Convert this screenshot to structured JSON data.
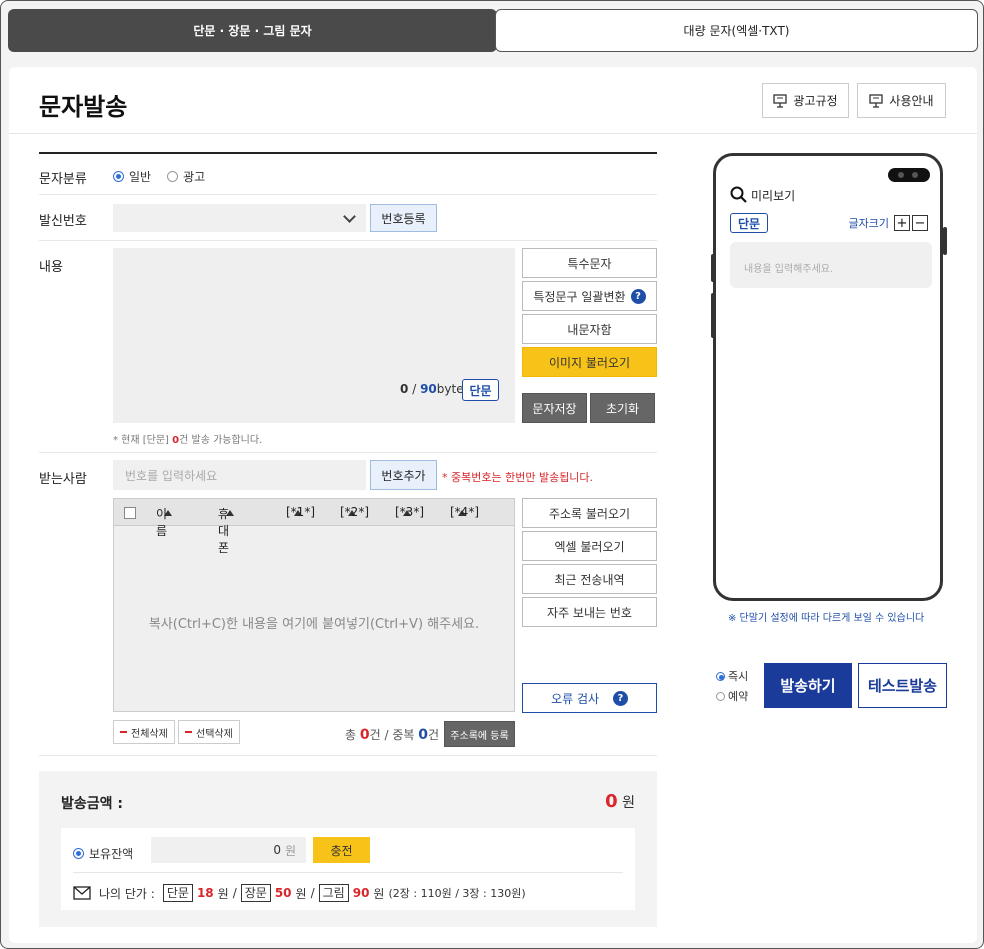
{
  "tabs": [
    {
      "label": "단문 · 장문 · 그림 문자",
      "active": true
    },
    {
      "label": "대량 문자(엑셀·TXT)",
      "active": false
    }
  ],
  "header": {
    "title": "문자발송",
    "ad_rules_label": "광고규정",
    "guide_label": "사용안내"
  },
  "category": {
    "label": "문자분류",
    "options": [
      {
        "label": "일반",
        "selected": true
      },
      {
        "label": "광고",
        "selected": false
      }
    ]
  },
  "sender": {
    "label": "발신번호",
    "selected": "",
    "register_label": "번호등록"
  },
  "content": {
    "label": "내용",
    "byte_current": "0",
    "byte_sep": "/",
    "byte_max": "90",
    "byte_unit": "byte",
    "type_badge": "단문",
    "note_prefix": "* 현재 [단문]",
    "note_count": "0",
    "note_suffix": "건 발송 가능합니다.",
    "buttons": {
      "special_chars": "특수문자",
      "bulk_convert": "특정문구 일괄변환",
      "my_messages": "내문자함",
      "load_image": "이미지 불러오기",
      "save": "문자저장",
      "reset": "초기화"
    }
  },
  "recipient": {
    "label": "받는사람",
    "placeholder": "번호를 입력하세요",
    "add_label": "번호추가",
    "dup_note": "* 중복번호는 한번만 발송됩니다.",
    "columns": [
      "이름",
      "휴대폰",
      "[*1*]",
      "[*2*]",
      "[*3*]",
      "[*4*]"
    ],
    "paste_hint": "복사(Ctrl+C)한 내용을 여기에 붙여넣기(Ctrl+V) 해주세요.",
    "buttons": {
      "address_book": "주소록 불러오기",
      "excel": "엑셀 불러오기",
      "recent": "최근 전송내역",
      "frequent": "자주 보내는 번호",
      "error_check": "오류 검사"
    },
    "delete_all": "전체삭제",
    "delete_selected": "선택삭제",
    "total_label": "총",
    "total_count": "0",
    "count_unit": "건",
    "dup_label": "/ 중복",
    "dup_count": "0",
    "register_address": "주소록에 등록"
  },
  "amount": {
    "label": "발송금액 :",
    "value": "0",
    "unit": "원",
    "balance_label": "보유잔액",
    "balance_value": "0",
    "balance_unit": "원",
    "charge_label": "충전",
    "unit_price_label": "나의 단가 :",
    "short_label": "단문",
    "short_price": "18",
    "long_label": "장문",
    "long_price": "50",
    "image_label": "그림",
    "image_price": "90",
    "won": "원",
    "slash": "/",
    "extra": "(2장 : 110원 / 3장 : 130원)"
  },
  "preview": {
    "title": "미리보기",
    "type_badge": "단문",
    "font_size_label": "글자크기",
    "placeholder": "내용을 입력해주세요.",
    "notice": "※ 단말기 설정에 따라 다르게 보일 수 있습니다"
  },
  "send": {
    "instant": "즉시",
    "reserve": "예약",
    "instant_selected": true,
    "send_label": "발송하기",
    "test_label": "테스트발송"
  },
  "colors": {
    "primary": "#1a3b99",
    "accent_yellow": "#f8c319",
    "red": "#d8262b"
  }
}
